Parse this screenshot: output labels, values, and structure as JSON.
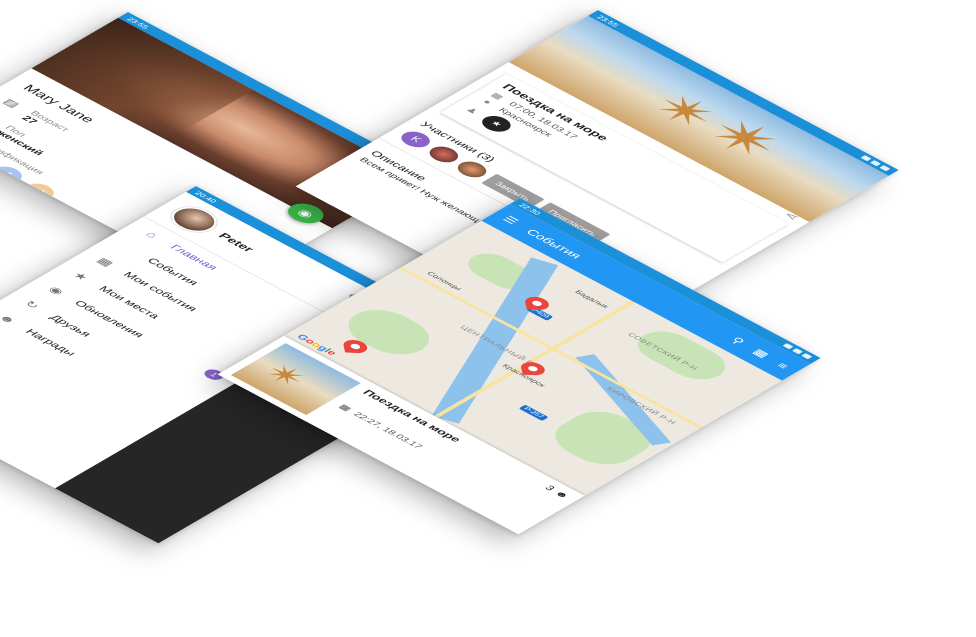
{
  "profile": {
    "status_time": "23:55",
    "name": "Mary Jane",
    "age_label": "Возраст",
    "age_value": "27",
    "gender_label": "Пол",
    "gender_value": "женский",
    "verification_label": "Верификация",
    "social": [
      "vk",
      "f",
      "ok"
    ],
    "icons": [
      "camera-icon",
      "cake-icon",
      "gender-icon",
      "verified-icon"
    ]
  },
  "event_detail": {
    "status_time": "23:55",
    "title": "Поездка на море",
    "datetime": "07:00, 18.03.17",
    "location": "Красноярск",
    "participants_label": "Участники (3)",
    "participant_initial": "K",
    "close_button": "Закрыть",
    "invite_button": "Пригласить",
    "description_label": "Описание",
    "description_text": "Всем привет! Нуж желающих съездить"
  },
  "drawer": {
    "status_time": "20:40",
    "user_name": "Peter",
    "menu": [
      {
        "label": "Главная",
        "icon": "home-icon",
        "active": true
      },
      {
        "label": "События",
        "icon": "",
        "active": false
      },
      {
        "label": "Мои события",
        "icon": "calendar-icon",
        "active": false
      },
      {
        "label": "Мои места",
        "icon": "star-icon",
        "active": false
      },
      {
        "label": "Обновления",
        "icon": "place-icon",
        "active": false
      },
      {
        "label": "Друзья",
        "icon": "refresh-icon",
        "active": false
      },
      {
        "label": "Награды",
        "icon": "people-icon",
        "active": false
      }
    ],
    "updates_badge": "1"
  },
  "map": {
    "status_time": "22:30",
    "title": "События",
    "labels": {
      "badalyk": "Бадалык",
      "sovetsky": "СОВЕТСКИЙ Р-Н",
      "solontsy": "Солонцы",
      "central": "ЦЕНТРАЛЬНЫЙ Р-Н",
      "krasnoyarsk": "Красноярск",
      "kirovsky": "КИРОВСКИЙ Р-Н",
      "r257": "P-257",
      "r409": "P409"
    },
    "sheet_title": "Поездка на море",
    "sheet_count": "3",
    "sheet_time": "22:27, 18.03.17",
    "google": [
      "G",
      "o",
      "o",
      "g",
      "l",
      "e"
    ]
  },
  "colors": {
    "primary": "#2196f3",
    "accent": "#7b5fd4",
    "green": "#3bb54a",
    "pin": "#e8453c"
  }
}
